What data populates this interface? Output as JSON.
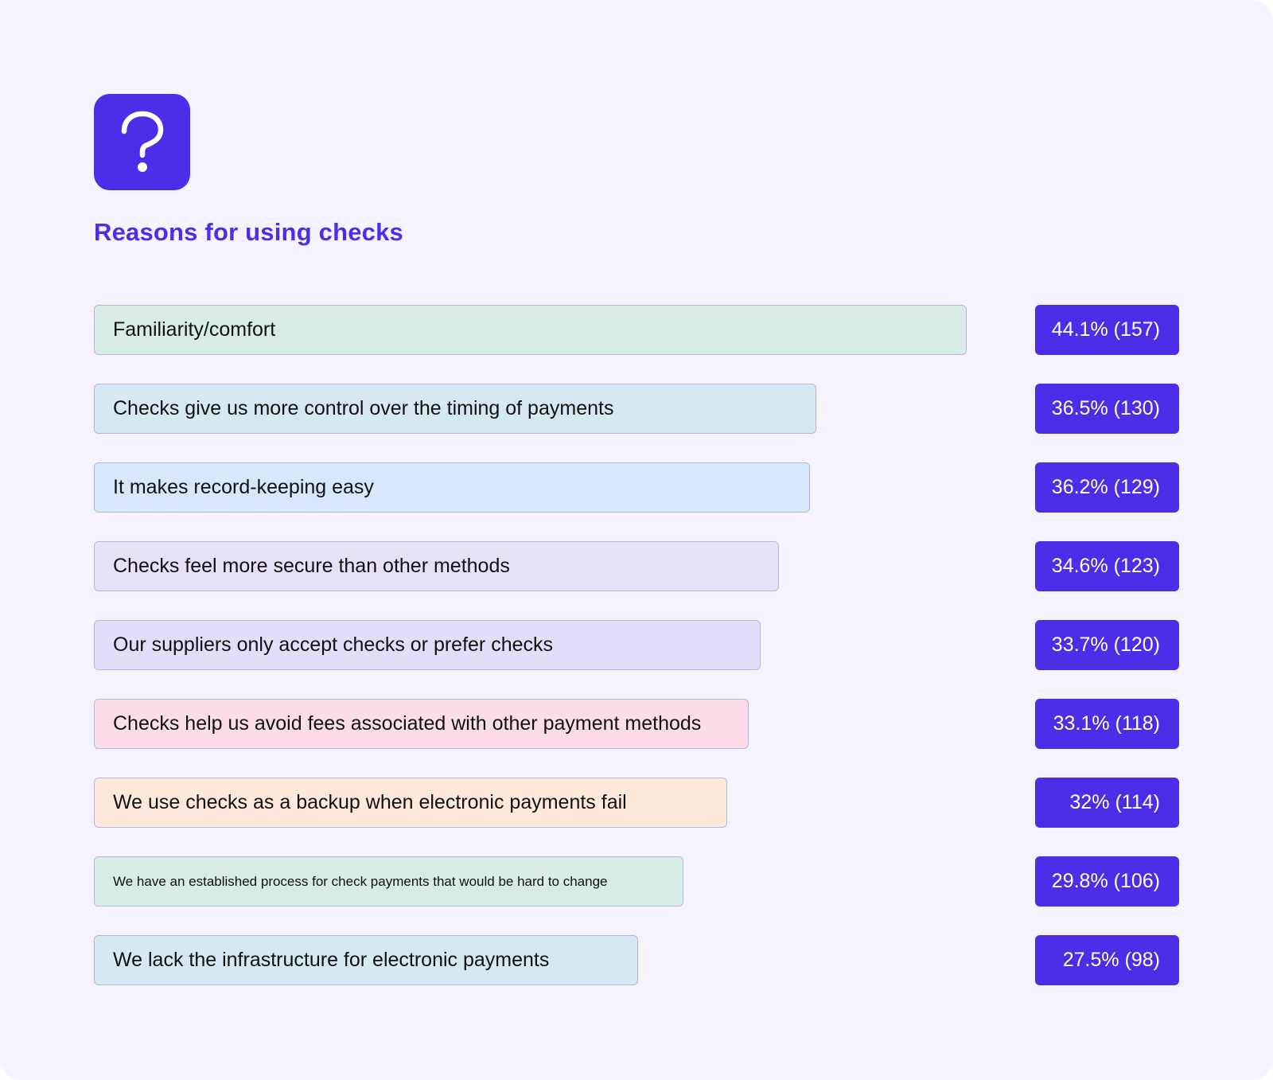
{
  "icon": "question-mark-icon",
  "colors": {
    "accent": "#4a2ee8",
    "background": "#f5f3ff",
    "bar_border": "#b7b3ea"
  },
  "chart_data": {
    "type": "bar",
    "orientation": "horizontal",
    "title": "Reasons for using checks",
    "xlabel": "",
    "ylabel": "",
    "xlim": [
      0,
      44.1
    ],
    "grid": false,
    "categories": [
      "Familiarity/comfort",
      "Checks give us more control over the timing of payments",
      "It makes record-keeping easy",
      "Checks feel more secure than other methods",
      "Our suppliers only accept checks or prefer checks",
      "Checks help us avoid fees associated with other payment methods",
      "We use checks as a backup when electronic payments fail",
      "We have an established process for check payments that would be hard to change",
      "We lack the infrastructure for electronic payments"
    ],
    "values": [
      44.1,
      36.5,
      36.2,
      34.6,
      33.7,
      33.1,
      32,
      29.8,
      27.5
    ],
    "counts": [
      157,
      130,
      129,
      123,
      120,
      118,
      114,
      106,
      98
    ],
    "value_labels": [
      "44.1% (157)",
      "36.5% (130)",
      "36.2% (129)",
      "34.6% (123)",
      "33.7% (120)",
      "33.1% (118)",
      "32% (114)",
      "29.8% (106)",
      "27.5% (98)"
    ],
    "bar_colors": [
      "#d6ece4",
      "#d4eaf0",
      "#d8e8fc",
      "#e8e0f7",
      "#dfdff9",
      "#fadde8",
      "#fde8d9",
      "#d6ece4",
      "#d4eaf0"
    ],
    "small_label_index": 7
  }
}
